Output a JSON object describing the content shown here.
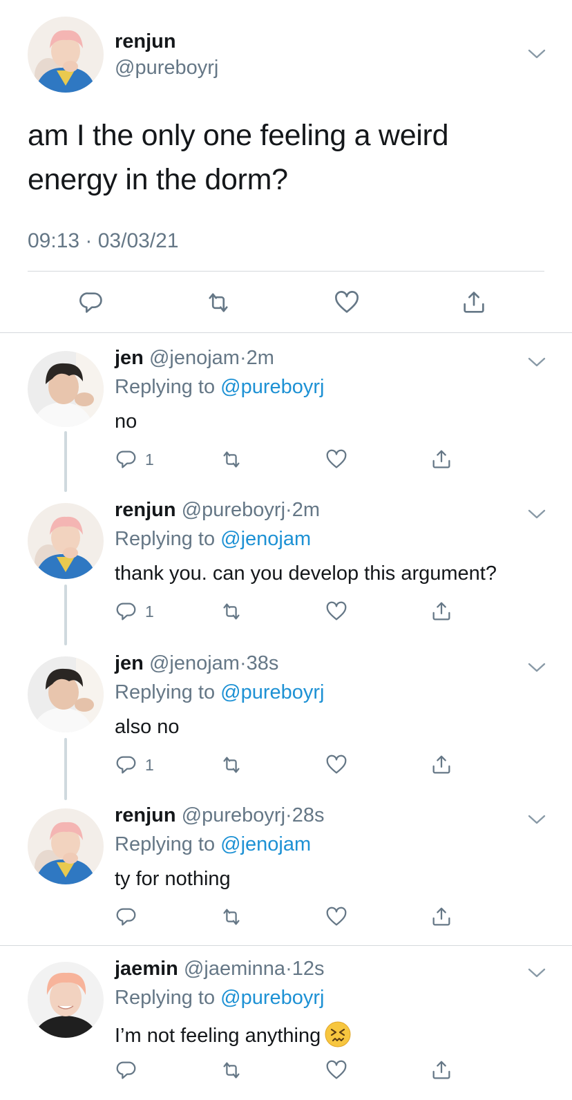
{
  "main_tweet": {
    "author_name": "renjun",
    "author_handle": "@pureboyrj",
    "text": "am I the only one feeling a weird energy in the dorm?",
    "timestamp": "09:13 · 03/03/21",
    "avatar": "renjun-avatar",
    "actions": [
      "reply-icon",
      "retweet-icon",
      "like-icon",
      "share-icon"
    ]
  },
  "replies": [
    {
      "author_name": "jen",
      "author_handle": "@jenojam",
      "time": "2m",
      "replying_prefix": "Replying to",
      "replying_to": "@pureboyrj",
      "text": "no",
      "reply_count": "1"
    },
    {
      "author_name": "renjun",
      "author_handle": "@pureboyrj",
      "time": "2m",
      "replying_prefix": "Replying to",
      "replying_to": "@jenojam",
      "text": "thank you. can you develop this argument?",
      "reply_count": "1"
    },
    {
      "author_name": "jen",
      "author_handle": "@jenojam",
      "time": "38s",
      "replying_prefix": "Replying to",
      "replying_to": "@pureboyrj",
      "text": "also no",
      "reply_count": "1"
    },
    {
      "author_name": "renjun",
      "author_handle": "@pureboyrj",
      "time": "28s",
      "replying_prefix": "Replying to",
      "replying_to": "@jenojam",
      "text": "ty for nothing",
      "reply_count": ""
    },
    {
      "author_name": "jaemin",
      "author_handle": "@jaeminna",
      "time": "12s",
      "replying_prefix": "Replying to",
      "replying_to": "@pureboyrj",
      "text": "I’m not feeling anything",
      "reply_count": "",
      "emoji": "confounded-face-emoji"
    }
  ],
  "separator_dot": "·",
  "colors": {
    "text": "#14171a",
    "secondary": "#657786",
    "link": "#1d91d4",
    "divider": "#d4d8dc",
    "thread_line": "#cfd9de"
  }
}
